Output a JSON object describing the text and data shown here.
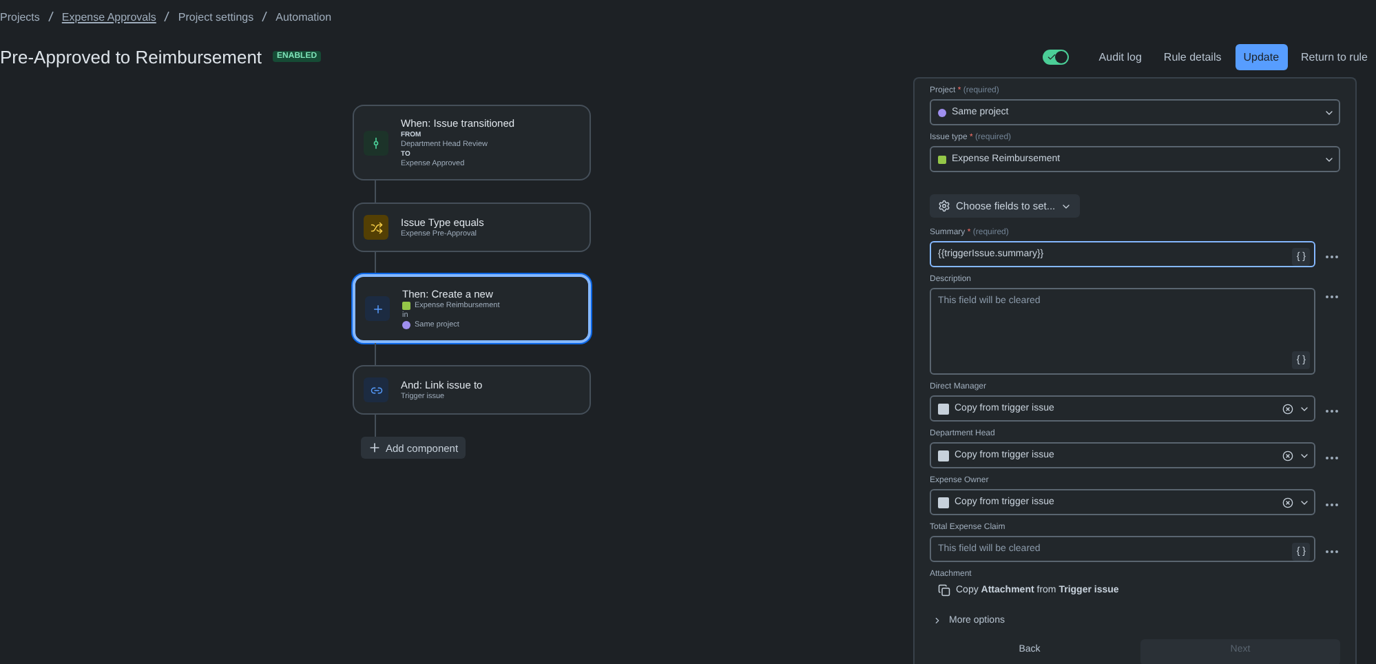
{
  "breadcrumbs": [
    {
      "label": "Projects",
      "link": false
    },
    {
      "label": "Expense Approvals",
      "link": true
    },
    {
      "label": "Project settings",
      "link": false
    },
    {
      "label": "Automation",
      "link": false
    }
  ],
  "title": "Pre-Approved to Reimbursement",
  "status_badge": "ENABLED",
  "rule_enabled": {
    "on": true
  },
  "actions": [
    {
      "label": "Audit log",
      "kind": "subtle"
    },
    {
      "label": "Rule details",
      "kind": "subtle"
    },
    {
      "label": "Update",
      "kind": "primary"
    },
    {
      "label": "Return to rule",
      "kind": "subtle"
    }
  ],
  "components": [
    {
      "kind": "transition",
      "title": "When: Issue transitioned",
      "selected": false,
      "details": [
        {
          "kind": "caption",
          "text": "FROM"
        },
        {
          "kind": "text",
          "text": "Department Head Review"
        },
        {
          "kind": "caption",
          "text": "TO"
        },
        {
          "kind": "text",
          "text": "Expense Approved"
        }
      ]
    },
    {
      "kind": "condition",
      "title": "Issue Type equals",
      "selected": false,
      "details": [
        {
          "kind": "text",
          "text": "Expense Pre-Approval"
        }
      ]
    },
    {
      "kind": "create",
      "title": "Then: Create a new",
      "selected": true,
      "details": [
        {
          "kind": "issuetype",
          "text": "Expense Reimbursement"
        },
        {
          "kind": "text",
          "text": "in"
        },
        {
          "kind": "project",
          "text": "Same project"
        }
      ]
    },
    {
      "kind": "link",
      "title": "And: Link issue to",
      "selected": false,
      "details": [
        {
          "kind": "text",
          "text": "Trigger issue"
        }
      ]
    }
  ],
  "add_component": "Add component",
  "panel": {
    "fields": [
      {
        "kind": "project",
        "label": "Project",
        "required_mark": "*",
        "required_note": "(required)",
        "value": "Same project"
      },
      {
        "kind": "issuetype",
        "label": "Issue type",
        "required_mark": "*",
        "required_note": "(required)",
        "value": "Expense Reimbursement"
      },
      {
        "kind": "chooser",
        "label": "Choose fields to set..."
      },
      {
        "kind": "text",
        "label": "Summary",
        "required_mark": "*",
        "required_note": "(required)",
        "value": "{{triggerIssue.summary}}",
        "focused": true,
        "smart": "{ }"
      },
      {
        "kind": "textarea",
        "label": "Description",
        "placeholder": "This field will be cleared",
        "smart": "{ }"
      },
      {
        "kind": "user",
        "label": "Direct Manager",
        "value": "Copy from trigger issue"
      },
      {
        "kind": "user",
        "label": "Department Head",
        "value": "Copy from trigger issue"
      },
      {
        "kind": "user",
        "label": "Expense Owner",
        "value": "Copy from trigger issue"
      },
      {
        "kind": "text",
        "label": "Total Expense Claim",
        "placeholder": "This field will be cleared",
        "focused": false,
        "smart": "{ }"
      },
      {
        "kind": "attachment",
        "label": "Attachment",
        "value": "Copy **Attachment** from **Trigger issue**"
      }
    ],
    "more_options": "More options",
    "back": "Back",
    "next": {
      "label": "Next",
      "disabled": true
    }
  }
}
